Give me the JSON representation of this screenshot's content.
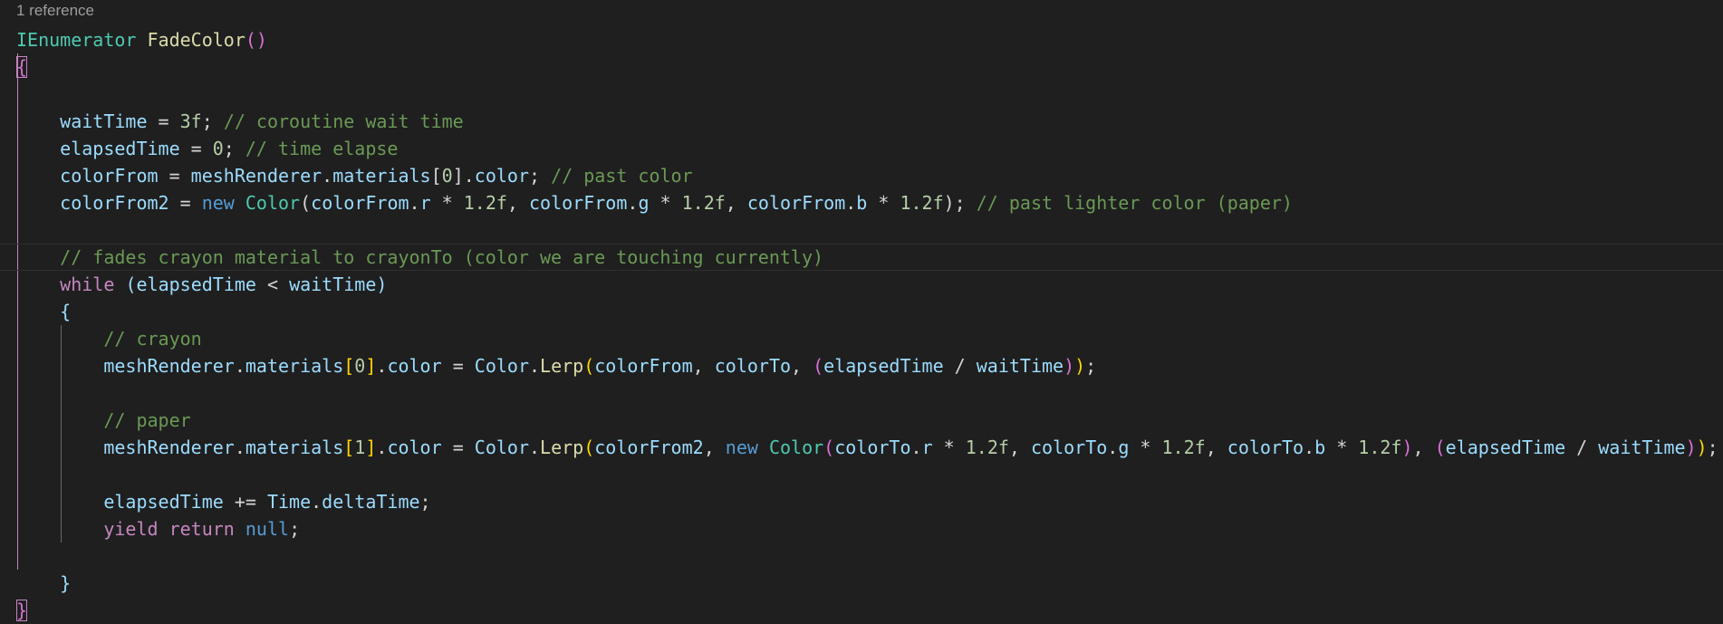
{
  "codelens": "1 reference",
  "lines": [
    [
      {
        "t": "IEnumerator",
        "c": "ty"
      },
      {
        "t": " ",
        "c": "p"
      },
      {
        "t": "FadeColor",
        "c": "fn"
      },
      {
        "t": "()",
        "c": "b2"
      }
    ],
    [
      {
        "t": "{",
        "c": "b2 bm"
      }
    ],
    [],
    [
      {
        "t": "    ",
        "c": "p"
      },
      {
        "t": "waitTime",
        "c": "var"
      },
      {
        "t": " = ",
        "c": "p"
      },
      {
        "t": "3f",
        "c": "num"
      },
      {
        "t": "; ",
        "c": "p"
      },
      {
        "t": "// coroutine wait time",
        "c": "cm"
      }
    ],
    [
      {
        "t": "    ",
        "c": "p"
      },
      {
        "t": "elapsedTime",
        "c": "var"
      },
      {
        "t": " = ",
        "c": "p"
      },
      {
        "t": "0",
        "c": "num"
      },
      {
        "t": "; ",
        "c": "p"
      },
      {
        "t": "// time elapse",
        "c": "cm"
      }
    ],
    [
      {
        "t": "    ",
        "c": "p"
      },
      {
        "t": "colorFrom",
        "c": "var"
      },
      {
        "t": " = ",
        "c": "p"
      },
      {
        "t": "meshRenderer",
        "c": "var"
      },
      {
        "t": ".",
        "c": "p"
      },
      {
        "t": "materials",
        "c": "var"
      },
      {
        "t": "[",
        "c": "p"
      },
      {
        "t": "0",
        "c": "num"
      },
      {
        "t": "].",
        "c": "p"
      },
      {
        "t": "color",
        "c": "var"
      },
      {
        "t": "; ",
        "c": "p"
      },
      {
        "t": "// past color",
        "c": "cm"
      }
    ],
    [
      {
        "t": "    ",
        "c": "p"
      },
      {
        "t": "colorFrom2",
        "c": "var"
      },
      {
        "t": " = ",
        "c": "p"
      },
      {
        "t": "new",
        "c": "kw"
      },
      {
        "t": " ",
        "c": "p"
      },
      {
        "t": "Color",
        "c": "ty"
      },
      {
        "t": "(",
        "c": "p"
      },
      {
        "t": "colorFrom",
        "c": "var"
      },
      {
        "t": ".",
        "c": "p"
      },
      {
        "t": "r",
        "c": "var"
      },
      {
        "t": " * ",
        "c": "p"
      },
      {
        "t": "1.2f",
        "c": "num"
      },
      {
        "t": ", ",
        "c": "p"
      },
      {
        "t": "colorFrom",
        "c": "var"
      },
      {
        "t": ".",
        "c": "p"
      },
      {
        "t": "g",
        "c": "var"
      },
      {
        "t": " * ",
        "c": "p"
      },
      {
        "t": "1.2f",
        "c": "num"
      },
      {
        "t": ", ",
        "c": "p"
      },
      {
        "t": "colorFrom",
        "c": "var"
      },
      {
        "t": ".",
        "c": "p"
      },
      {
        "t": "b",
        "c": "var"
      },
      {
        "t": " * ",
        "c": "p"
      },
      {
        "t": "1.2f",
        "c": "num"
      },
      {
        "t": "); ",
        "c": "p"
      },
      {
        "t": "// past lighter color (paper)",
        "c": "cm"
      }
    ],
    [],
    [
      {
        "t": "    ",
        "c": "p"
      },
      {
        "t": "// fades crayon material to crayonTo (color we are touching currently)",
        "c": "cm"
      }
    ],
    [
      {
        "t": "    ",
        "c": "p"
      },
      {
        "t": "while",
        "c": "kwc"
      },
      {
        "t": " ",
        "c": "p"
      },
      {
        "t": "(",
        "c": "var"
      },
      {
        "t": "elapsedTime",
        "c": "var"
      },
      {
        "t": " < ",
        "c": "p"
      },
      {
        "t": "waitTime",
        "c": "var"
      },
      {
        "t": ")",
        "c": "var"
      }
    ],
    [
      {
        "t": "    ",
        "c": "p"
      },
      {
        "t": "{",
        "c": "var"
      }
    ],
    [
      {
        "t": "        ",
        "c": "p"
      },
      {
        "t": "// crayon",
        "c": "cm"
      }
    ],
    [
      {
        "t": "        ",
        "c": "p"
      },
      {
        "t": "meshRenderer",
        "c": "var"
      },
      {
        "t": ".",
        "c": "p"
      },
      {
        "t": "materials",
        "c": "var"
      },
      {
        "t": "[",
        "c": "b1"
      },
      {
        "t": "0",
        "c": "num"
      },
      {
        "t": "]",
        "c": "b1"
      },
      {
        "t": ".",
        "c": "p"
      },
      {
        "t": "color",
        "c": "var"
      },
      {
        "t": " = ",
        "c": "p"
      },
      {
        "t": "Color",
        "c": "var"
      },
      {
        "t": ".",
        "c": "p"
      },
      {
        "t": "Lerp",
        "c": "fn"
      },
      {
        "t": "(",
        "c": "b1"
      },
      {
        "t": "colorFrom",
        "c": "var"
      },
      {
        "t": ", ",
        "c": "p"
      },
      {
        "t": "colorTo",
        "c": "var"
      },
      {
        "t": ", ",
        "c": "p"
      },
      {
        "t": "(",
        "c": "b2"
      },
      {
        "t": "elapsedTime",
        "c": "var"
      },
      {
        "t": " / ",
        "c": "p"
      },
      {
        "t": "waitTime",
        "c": "var"
      },
      {
        "t": ")",
        "c": "b2"
      },
      {
        "t": ")",
        "c": "b1"
      },
      {
        "t": ";",
        "c": "p"
      }
    ],
    [],
    [
      {
        "t": "        ",
        "c": "p"
      },
      {
        "t": "// paper",
        "c": "cm"
      }
    ],
    [
      {
        "t": "        ",
        "c": "p"
      },
      {
        "t": "meshRenderer",
        "c": "var"
      },
      {
        "t": ".",
        "c": "p"
      },
      {
        "t": "materials",
        "c": "var"
      },
      {
        "t": "[",
        "c": "b1"
      },
      {
        "t": "1",
        "c": "num"
      },
      {
        "t": "]",
        "c": "b1"
      },
      {
        "t": ".",
        "c": "p"
      },
      {
        "t": "color",
        "c": "var"
      },
      {
        "t": " = ",
        "c": "p"
      },
      {
        "t": "Color",
        "c": "var"
      },
      {
        "t": ".",
        "c": "p"
      },
      {
        "t": "Lerp",
        "c": "fn"
      },
      {
        "t": "(",
        "c": "b1"
      },
      {
        "t": "colorFrom2",
        "c": "var"
      },
      {
        "t": ", ",
        "c": "p"
      },
      {
        "t": "new",
        "c": "kw"
      },
      {
        "t": " ",
        "c": "p"
      },
      {
        "t": "Color",
        "c": "ty"
      },
      {
        "t": "(",
        "c": "b2"
      },
      {
        "t": "colorTo",
        "c": "var"
      },
      {
        "t": ".",
        "c": "p"
      },
      {
        "t": "r",
        "c": "var"
      },
      {
        "t": " * ",
        "c": "p"
      },
      {
        "t": "1.2f",
        "c": "num"
      },
      {
        "t": ", ",
        "c": "p"
      },
      {
        "t": "colorTo",
        "c": "var"
      },
      {
        "t": ".",
        "c": "p"
      },
      {
        "t": "g",
        "c": "var"
      },
      {
        "t": " * ",
        "c": "p"
      },
      {
        "t": "1.2f",
        "c": "num"
      },
      {
        "t": ", ",
        "c": "p"
      },
      {
        "t": "colorTo",
        "c": "var"
      },
      {
        "t": ".",
        "c": "p"
      },
      {
        "t": "b",
        "c": "var"
      },
      {
        "t": " * ",
        "c": "p"
      },
      {
        "t": "1.2f",
        "c": "num"
      },
      {
        "t": ")",
        "c": "b2"
      },
      {
        "t": ", ",
        "c": "p"
      },
      {
        "t": "(",
        "c": "b2"
      },
      {
        "t": "elapsedTime",
        "c": "var"
      },
      {
        "t": " / ",
        "c": "p"
      },
      {
        "t": "waitTime",
        "c": "var"
      },
      {
        "t": ")",
        "c": "b2"
      },
      {
        "t": ")",
        "c": "b1"
      },
      {
        "t": ";",
        "c": "p"
      }
    ],
    [],
    [
      {
        "t": "        ",
        "c": "p"
      },
      {
        "t": "elapsedTime",
        "c": "var"
      },
      {
        "t": " += ",
        "c": "p"
      },
      {
        "t": "Time",
        "c": "var"
      },
      {
        "t": ".",
        "c": "p"
      },
      {
        "t": "deltaTime",
        "c": "var"
      },
      {
        "t": ";",
        "c": "p"
      }
    ],
    [
      {
        "t": "        ",
        "c": "p"
      },
      {
        "t": "yield",
        "c": "kwc"
      },
      {
        "t": " ",
        "c": "p"
      },
      {
        "t": "return",
        "c": "kwc"
      },
      {
        "t": " ",
        "c": "p"
      },
      {
        "t": "null",
        "c": "kw"
      },
      {
        "t": ";",
        "c": "p"
      }
    ],
    [],
    [
      {
        "t": "    ",
        "c": "p"
      },
      {
        "t": "}",
        "c": "var"
      }
    ],
    [
      {
        "t": "}",
        "c": "b2 bm"
      }
    ]
  ],
  "current_line": 8
}
